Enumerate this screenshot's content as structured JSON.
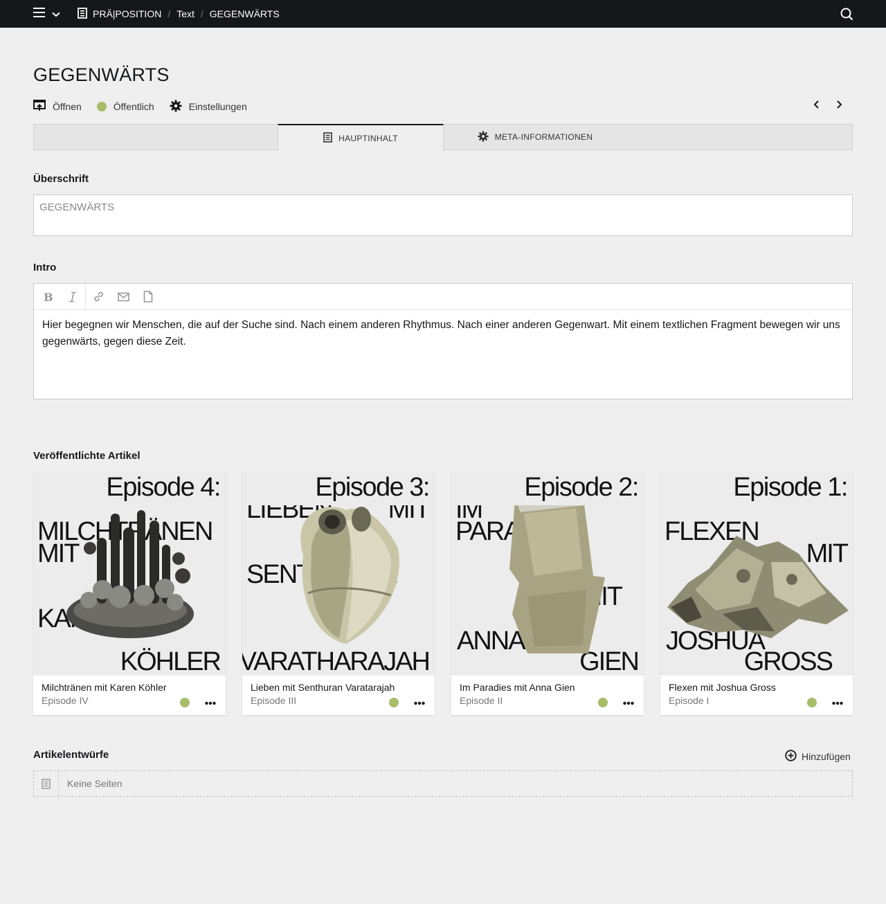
{
  "topbar": {
    "breadcrumbs": [
      "PRÄ|POSITION",
      "Text",
      "GEGENWÄRTS"
    ],
    "breadcrumb_separator": "/"
  },
  "header": {
    "title": "GEGENWÄRTS",
    "actions": {
      "open": "Öffnen",
      "status": "Öffentlich",
      "settings": "Einstellungen"
    },
    "status_color": "#a7bd68"
  },
  "tabs": [
    {
      "label": "HAUPTINHALT",
      "icon": "page-icon",
      "active": true
    },
    {
      "label": "META-INFORMATIONEN",
      "icon": "gear-icon",
      "active": false
    }
  ],
  "fields": {
    "headline_label": "Überschrift",
    "headline_value": "GEGENWÄRTS",
    "intro_label": "Intro",
    "intro_text": "Hier begegnen wir Menschen, die auf der Suche sind. Nach einem anderen Rhythmus. Nach einer anderen Gegenwart. Mit einem textlichen Fragment bewegen wir uns gegenwärts, gegen diese Zeit."
  },
  "toolbar_icons": [
    "bold-icon",
    "italic-icon",
    "link-icon",
    "email-icon",
    "file-icon"
  ],
  "published": {
    "label": "Veröffentlichte Artikel",
    "cards": [
      {
        "cover_episode": "Episode 4:",
        "cover_words": [
          "MILCHTRÄNEN",
          "MIT",
          "KAREN",
          "KÖHLER"
        ],
        "title": "Milchtränen mit Karen Köhler",
        "subtitle": "Episode IV",
        "image": "cactus-collage"
      },
      {
        "cover_episode": "Episode 3:",
        "cover_words": [
          "LIEBEN",
          "MIT",
          "SENTHURAN",
          "VARATHARAJAH"
        ],
        "title": "Lieben mit Senthuran Varatarajah",
        "subtitle": "Episode III",
        "image": "heart-collage"
      },
      {
        "cover_episode": "Episode 2:",
        "cover_words": [
          "IM",
          "PARADIES",
          "MIT",
          "ANNA",
          "GIEN"
        ],
        "title": "Im Paradies mit Anna Gien",
        "subtitle": "Episode II",
        "image": "stone-collage"
      },
      {
        "cover_episode": "Episode 1:",
        "cover_words": [
          "FLEXEN",
          "MIT",
          "JOSHUA",
          "GROSS"
        ],
        "title": "Flexen mit Joshua Gross",
        "subtitle": "Episode I",
        "image": "rock-collage"
      }
    ]
  },
  "drafts": {
    "label": "Artikelentwürfe",
    "add_label": "Hinzufügen",
    "empty_text": "Keine Seiten"
  }
}
